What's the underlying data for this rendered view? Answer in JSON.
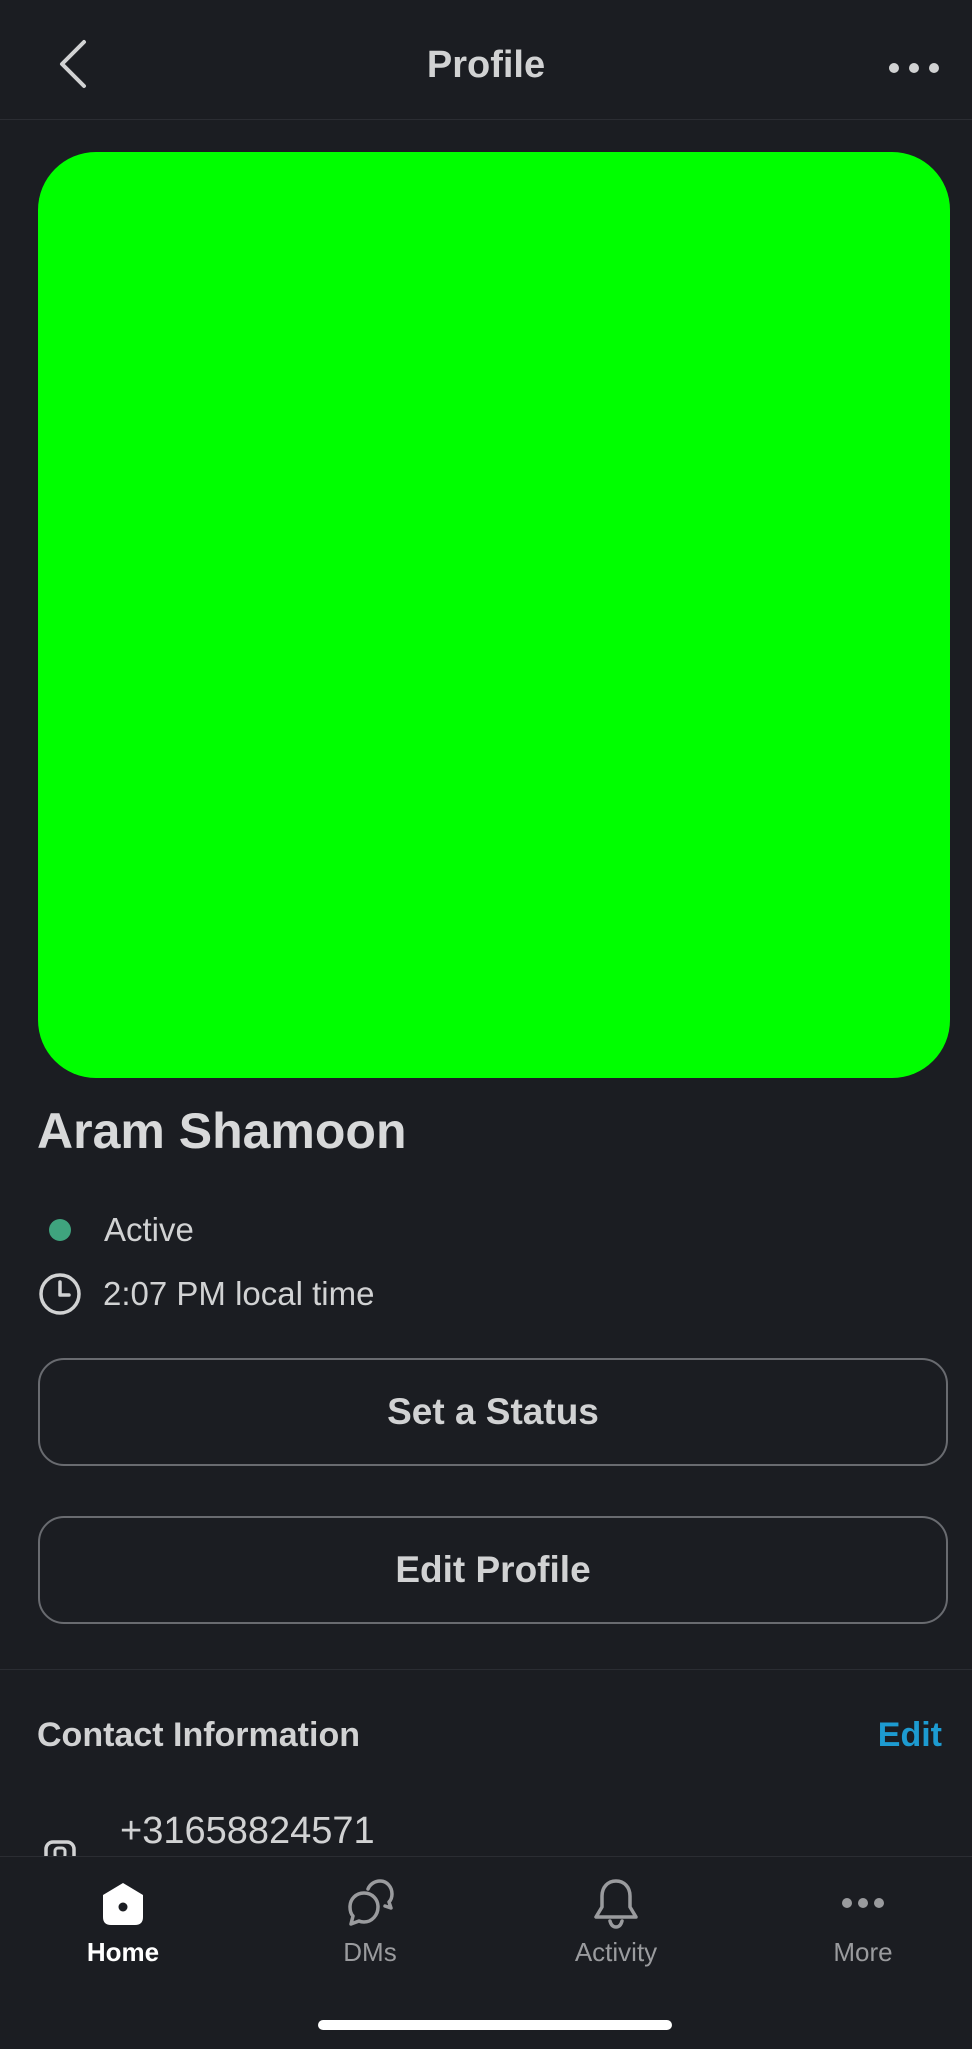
{
  "header": {
    "title": "Profile"
  },
  "profile": {
    "avatar_color": "#00ff00",
    "name": "Aram Shamoon",
    "presence": "Active",
    "presence_color": "#3fa47e",
    "local_time": "2:07 PM local time"
  },
  "actions": {
    "set_status_label": "Set a Status",
    "edit_profile_label": "Edit Profile"
  },
  "contact": {
    "title": "Contact Information",
    "edit_label": "Edit",
    "edit_color": "#1d9bd1",
    "phone": "+31658824571"
  },
  "tabbar": {
    "tabs": [
      {
        "label": "Home",
        "icon": "home-icon",
        "active": true
      },
      {
        "label": "DMs",
        "icon": "dms-icon",
        "active": false
      },
      {
        "label": "Activity",
        "icon": "bell-icon",
        "active": false
      },
      {
        "label": "More",
        "icon": "more-dots-icon",
        "active": false
      }
    ]
  }
}
